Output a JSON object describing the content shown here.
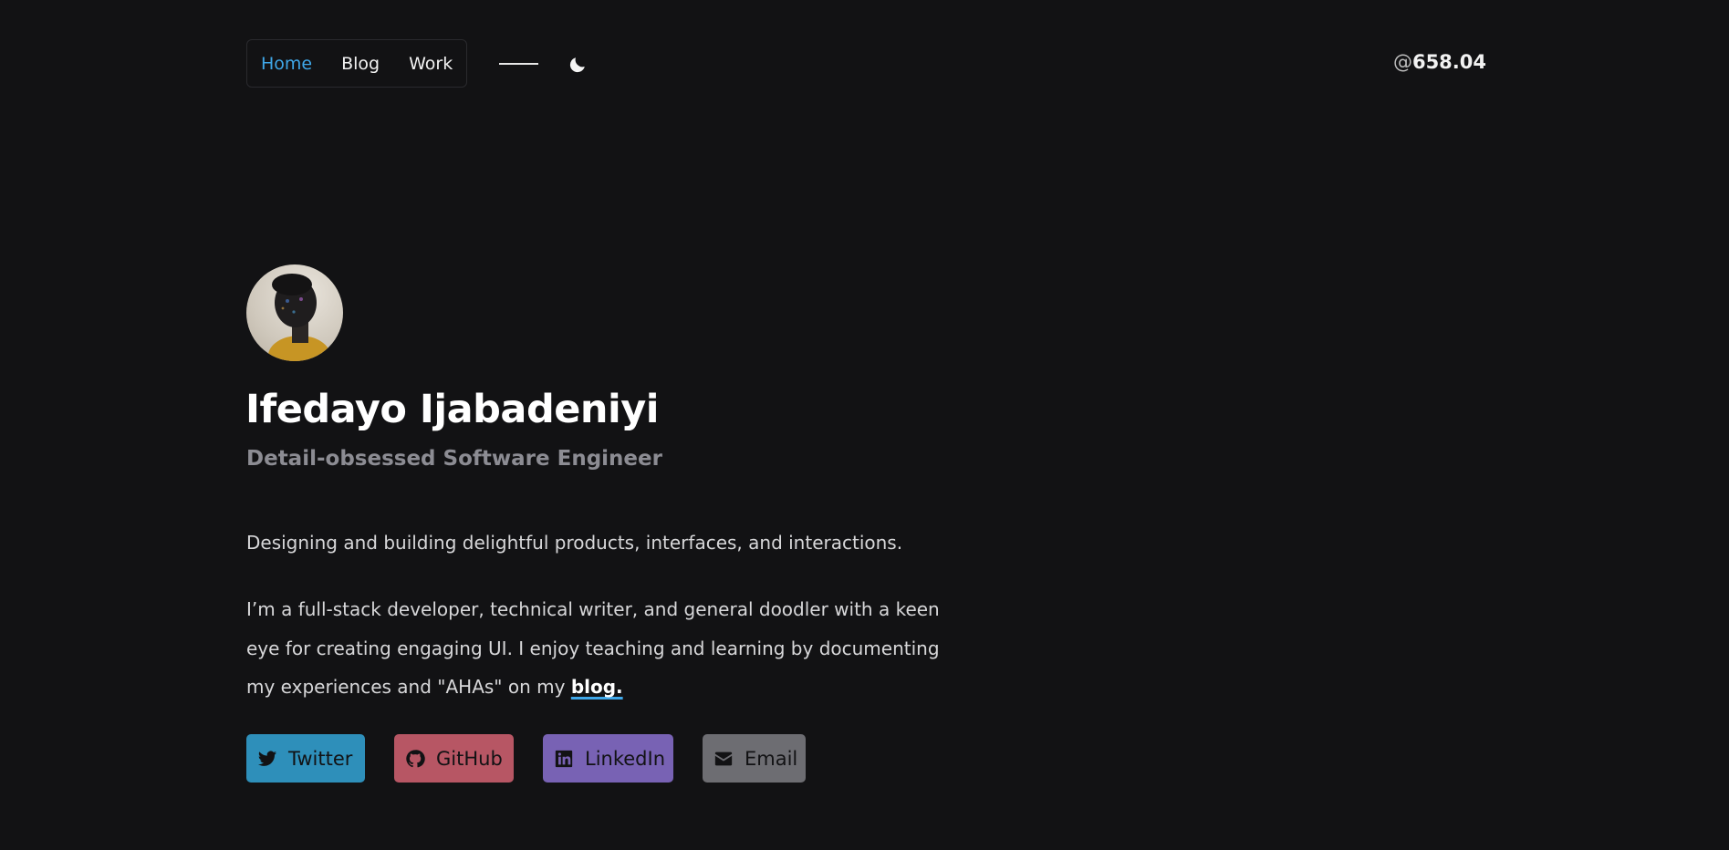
{
  "header": {
    "nav": [
      {
        "label": "Home",
        "active": true
      },
      {
        "label": "Blog",
        "active": false
      },
      {
        "label": "Work",
        "active": false
      }
    ],
    "theme_toggle_icon": "moon-icon",
    "handle_prefix": "@",
    "handle_value": "658.04"
  },
  "hero": {
    "name": "Ifedayo Ijabadeniyi",
    "subtitle": "Detail-obsessed Software Engineer",
    "tagline": "Designing and building delightful products, interfaces, and interactions.",
    "bio_text": "I’m a full-stack developer, technical writer, and general doodler with a keen eye for creating engaging UI. I enjoy teaching and learning by documenting my experiences and \"AHAs\" on my ",
    "bio_link": "blog."
  },
  "socials": [
    {
      "label": "Twitter",
      "icon": "twitter-icon",
      "color": "#2e8fba"
    },
    {
      "label": "GitHub",
      "icon": "github-icon",
      "color": "#b75664"
    },
    {
      "label": "LinkedIn",
      "icon": "linkedin-icon",
      "color": "#7862b4"
    },
    {
      "label": "Email",
      "icon": "mail-icon",
      "color": "#6d6d72"
    }
  ],
  "colors": {
    "background": "#121214",
    "accent": "#3fa7e8"
  }
}
